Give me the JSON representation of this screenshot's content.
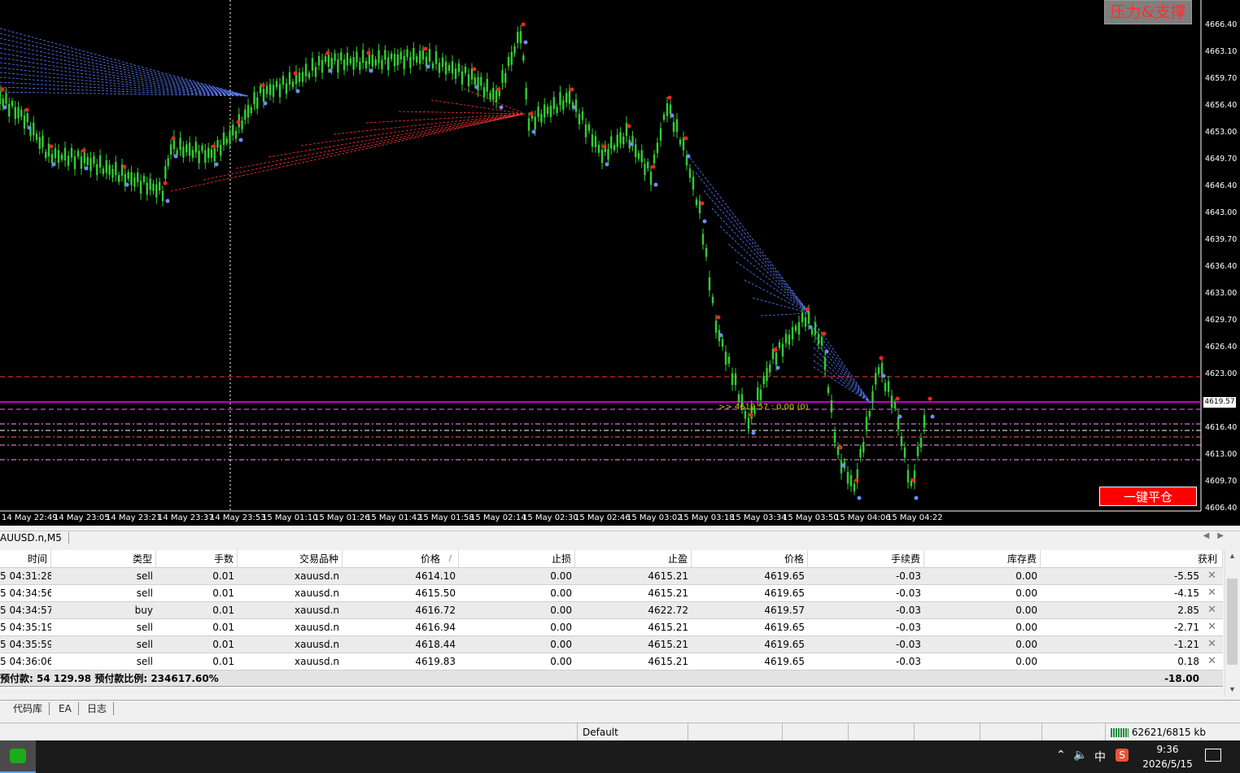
{
  "chart": {
    "symbol_tab": "AUUSD.n,M5",
    "sr_button": "压力&支撑",
    "close_all_button": "一键平仓",
    "current_price": "4619.57",
    "price_note": ">> 4619.57 : 0.00 (0)",
    "y_axis_labels": [
      "4666.40",
      "4663.10",
      "4659.70",
      "4656.40",
      "4653.00",
      "4649.70",
      "4646.40",
      "4643.00",
      "4639.70",
      "4636.40",
      "4633.00",
      "4629.70",
      "4626.40",
      "4623.00",
      "4616.40",
      "4613.00",
      "4609.70",
      "4606.40"
    ],
    "x_axis_labels": [
      "14 May 22:49",
      "14 May 23:05",
      "14 May 23:21",
      "14 May 23:37",
      "14 May 23:53",
      "15 May 01:10",
      "15 May 01:26",
      "15 May 01:42",
      "15 May 01:58",
      "15 May 02:14",
      "15 May 02:30",
      "15 May 02:46",
      "15 May 03:02",
      "15 May 03:18",
      "15 May 03:34",
      "15 May 03:50",
      "15 May 04:06",
      "15 May 04:22"
    ],
    "colors": {
      "background": "#000000",
      "candle": "#33cc33",
      "support": "#ff3333",
      "resistance": "#5b7cff",
      "current_line": "#ff00ff"
    }
  },
  "trade_table": {
    "columns": [
      "时间",
      "类型",
      "手数",
      "交易品种",
      "价格",
      "止损",
      "止盈",
      "价格",
      "手续费",
      "库存费",
      "获利"
    ],
    "sort_indicator": "/",
    "rows": [
      [
        "5 04:31:28",
        "sell",
        "0.01",
        "xauusd.n",
        "4614.10",
        "0.00",
        "4615.21",
        "4619.65",
        "-0.03",
        "0.00",
        "-5.55"
      ],
      [
        "5 04:34:56",
        "sell",
        "0.01",
        "xauusd.n",
        "4615.50",
        "0.00",
        "4615.21",
        "4619.65",
        "-0.03",
        "0.00",
        "-4.15"
      ],
      [
        "5 04:34:57",
        "buy",
        "0.01",
        "xauusd.n",
        "4616.72",
        "0.00",
        "4622.72",
        "4619.57",
        "-0.03",
        "0.00",
        "2.85"
      ],
      [
        "5 04:35:19",
        "sell",
        "0.01",
        "xauusd.n",
        "4616.94",
        "0.00",
        "4615.21",
        "4619.65",
        "-0.03",
        "0.00",
        "-2.71"
      ],
      [
        "5 04:35:59",
        "sell",
        "0.01",
        "xauusd.n",
        "4618.44",
        "0.00",
        "4615.21",
        "4619.65",
        "-0.03",
        "0.00",
        "-1.21"
      ],
      [
        "5 04:36:06",
        "sell",
        "0.01",
        "xauusd.n",
        "4619.83",
        "0.00",
        "4615.21",
        "4619.65",
        "-0.03",
        "0.00",
        "0.18"
      ]
    ],
    "close_glyph": "✕",
    "summary_text": "预付款: 54 129.98  预付款比例: 234617.60%",
    "summary_total": "-18.00"
  },
  "bottom_tabs": [
    "代码库",
    "EA",
    "日志"
  ],
  "status_bar": {
    "profile": "Default",
    "traffic": "62621/6815 kb"
  },
  "taskbar": {
    "time": "9:36",
    "date": "2026/5/15",
    "ime": "中"
  }
}
